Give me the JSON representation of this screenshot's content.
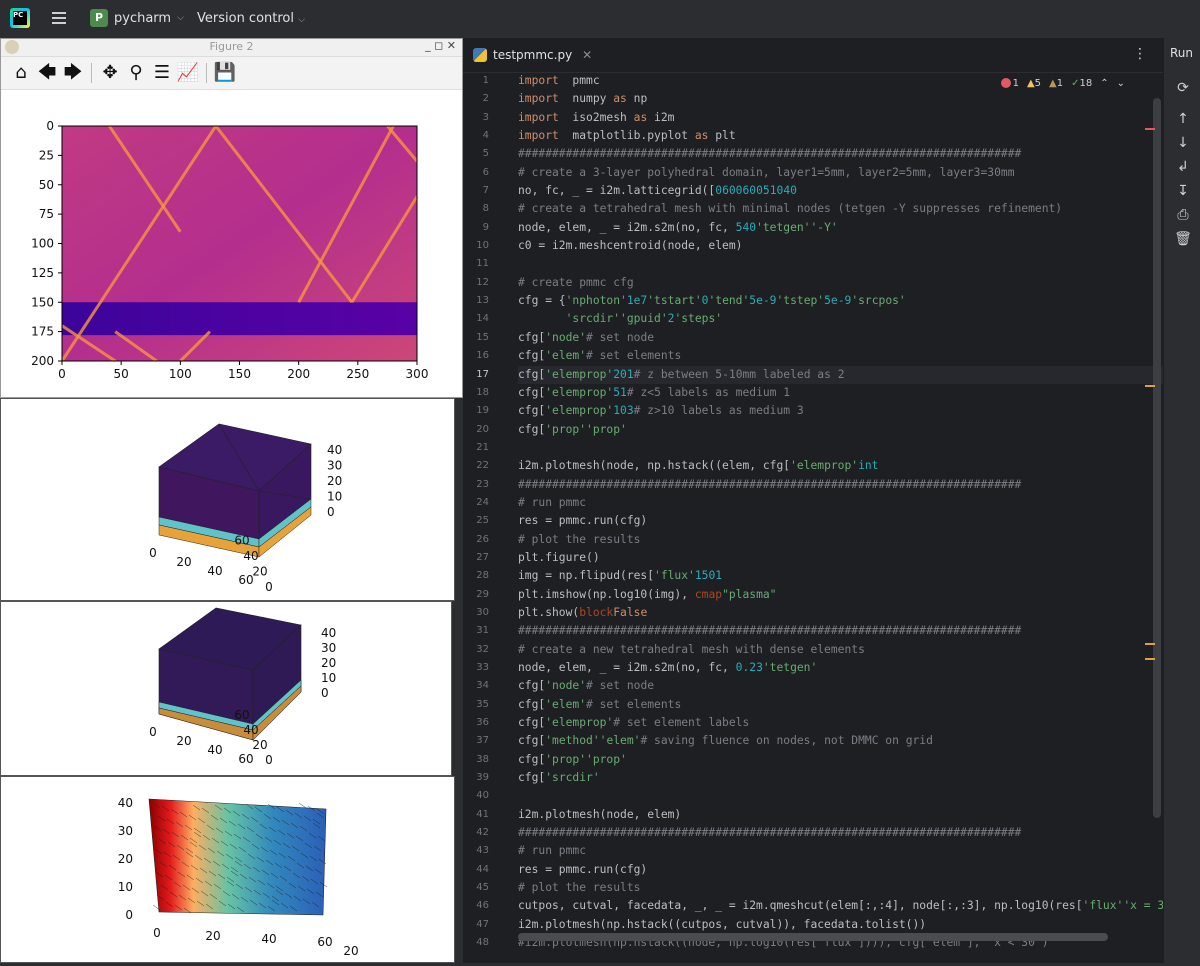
{
  "topbar": {
    "logo_text": "PC",
    "project_badge": "P",
    "project_name": "pycharm",
    "vcs_label": "Version control"
  },
  "figure_window": {
    "title": "Figure 2",
    "controls": "_ ◻ ✕",
    "toolbar_icons": [
      "home-icon",
      "back-icon",
      "forward-icon",
      "pan-icon",
      "zoom-icon",
      "configure-icon",
      "axes-icon",
      "save-icon"
    ]
  },
  "chart_data": [
    {
      "type": "heatmap",
      "x_ticks": [
        "0",
        "50",
        "100",
        "150",
        "200",
        "250",
        "300"
      ],
      "y_ticks": [
        "0",
        "25",
        "50",
        "75",
        "100",
        "125",
        "150",
        "175",
        "200"
      ],
      "xlim": [
        0,
        300
      ],
      "ylim": [
        200,
        0
      ],
      "colormap": "plasma"
    },
    {
      "type": "mesh3d",
      "x_ticks": [
        "0",
        "20",
        "40",
        "60"
      ],
      "y_ticks": [
        "0",
        "20",
        "40",
        "60"
      ],
      "z_ticks": [
        "0",
        "10",
        "20",
        "30",
        "40"
      ]
    },
    {
      "type": "mesh3d",
      "x_ticks": [
        "0",
        "20",
        "40",
        "60"
      ],
      "y_ticks": [
        "0",
        "20",
        "40",
        "60"
      ],
      "z_ticks": [
        "0",
        "10",
        "20",
        "30",
        "40"
      ]
    },
    {
      "type": "mesh3d",
      "x_ticks": [
        "0",
        "20",
        "40",
        "60"
      ],
      "z_ticks": [
        "0",
        "10",
        "20",
        "30",
        "40"
      ],
      "extra_label": "20"
    }
  ],
  "editor": {
    "tab_name": "testpmmc.py",
    "tab_close": "✕",
    "inspections": {
      "errors": "1",
      "warnings": "5",
      "weak": "1",
      "ok": "18"
    },
    "current_line": 17,
    "lines": [
      [
        [
          "kw",
          "import"
        ],
        [
          "",
          "  pmmc"
        ]
      ],
      [
        [
          "kw",
          "import"
        ],
        [
          "",
          "  numpy "
        ],
        [
          "kw",
          "as"
        ],
        [
          "",
          " np"
        ]
      ],
      [
        [
          "kw",
          "import"
        ],
        [
          "",
          "  iso2mesh "
        ],
        [
          "kw",
          "as"
        ],
        [
          "",
          " i2m"
        ]
      ],
      [
        [
          "kw",
          "import"
        ],
        [
          "",
          "  matplotlib.pyplot "
        ],
        [
          "kw",
          "as"
        ],
        [
          "",
          " plt"
        ]
      ],
      [
        [
          "cm",
          "##########################################################################"
        ]
      ],
      [
        [
          "cm",
          "# create a 3-layer polyhedral domain, layer1=5mm, layer2=5mm, layer3=30mm"
        ]
      ],
      [
        [
          "",
          "no, fc, _ = i2m.latticegrid(["
        ],
        [
          "nm",
          "0"
        ],
        [
          ", "
        ],
        [
          "nm",
          "60"
        ],
        [
          "], ["
        ],
        [
          "nm",
          "0"
        ],
        [
          ", "
        ],
        [
          "nm",
          "60"
        ],
        [
          "], ["
        ],
        [
          "nm",
          "0"
        ],
        [
          ", "
        ],
        [
          "nm",
          "5"
        ],
        [
          ", "
        ],
        [
          "nm",
          "10"
        ],
        [
          ", "
        ],
        [
          "nm",
          "40"
        ],
        [
          "])"
        ]
      ],
      [
        [
          "cm",
          "# create a tetrahedral mesh with minimal nodes (tetgen -Y suppresses refinement)"
        ]
      ],
      [
        [
          "",
          "node, elem, _ = i2m.s2m(no, fc, "
        ],
        [
          "nm",
          "5"
        ],
        [
          ", "
        ],
        [
          "nm",
          "40"
        ],
        [
          ", "
        ],
        [
          "st",
          "'tetgen'"
        ],
        [
          ", [[1,1,1],[1,1,6],[1,1,11]], [], "
        ],
        [
          "st",
          "'-Y'"
        ],
        [
          ")"
        ]
      ],
      [
        [
          "",
          "c0 = i2m.meshcentroid(node, elem)"
        ]
      ],
      [
        [
          "",
          ""
        ]
      ],
      [
        [
          "cm",
          "# create pmmc cfg"
        ]
      ],
      [
        [
          "",
          "cfg = {"
        ],
        [
          "st",
          "'nphoton'"
        ],
        [
          ": "
        ],
        [
          "nm",
          "1e7"
        ],
        [
          ", "
        ],
        [
          "st",
          "'tstart'"
        ],
        [
          ":"
        ],
        [
          "nm",
          "0"
        ],
        [
          ", "
        ],
        [
          "st",
          "'tend'"
        ],
        [
          ":"
        ],
        [
          "nm",
          "5e-9"
        ],
        [
          ", "
        ],
        [
          "st",
          "'tstep'"
        ],
        [
          ":"
        ],
        [
          "nm",
          "5e-9"
        ],
        [
          ", "
        ],
        [
          "st",
          "'srcpos'"
        ],
        [
          ": [30,5,0],"
        ]
      ],
      [
        [
          "",
          "       "
        ],
        [
          "st",
          "'srcdir'"
        ],
        [
          ": np.array([0,1,1])/(2**0.5), "
        ],
        [
          "st",
          "'gpuid'"
        ],
        [
          ": "
        ],
        [
          "nm",
          "2"
        ],
        [
          ", "
        ],
        [
          "st",
          "'steps'"
        ],
        [
          ": [0.2, 0.2, 0.2]}"
        ]
      ],
      [
        [
          "",
          "cfg["
        ],
        [
          "st",
          "'node'"
        ],
        [
          "]=node                                "
        ],
        [
          "cm",
          "# set node"
        ]
      ],
      [
        [
          "",
          "cfg["
        ],
        [
          "st",
          "'elem'"
        ],
        [
          "]=elem                                "
        ],
        [
          "cm",
          "# set elements"
        ]
      ],
      [
        [
          "",
          "cfg["
        ],
        [
          "st",
          "'elemprop'"
        ],
        [
          "] = "
        ],
        [
          "nm",
          "2"
        ],
        [
          "*np.ones((elem.shape["
        ],
        [
          "nm",
          "0"
        ],
        [
          "], "
        ],
        [
          "nm",
          "1"
        ],
        [
          ")) "
        ],
        [
          "cm",
          "# z between 5-10mm labeled as 2"
        ]
      ],
      [
        [
          "",
          "cfg["
        ],
        [
          "st",
          "'elemprop'"
        ],
        [
          "][c0[:,-1]<"
        ],
        [
          "nm",
          "5"
        ],
        [
          "] = "
        ],
        [
          "nm",
          "1"
        ],
        [
          "                  "
        ],
        [
          "cm",
          "# z<5 labels as medium 1"
        ]
      ],
      [
        [
          "",
          "cfg["
        ],
        [
          "st",
          "'elemprop'"
        ],
        [
          "][c0[:,-1]>"
        ],
        [
          "nm",
          "10"
        ],
        [
          "] = "
        ],
        [
          "nm",
          "3"
        ],
        [
          "                 "
        ],
        [
          "cm",
          "# z>10 labels as medium 3"
        ]
      ],
      [
        [
          "",
          "cfg["
        ],
        [
          "st",
          "'prop'"
        ],
        [
          "]=cfg["
        ],
        [
          "st",
          "'prop'"
        ],
        [
          "]=[[0,0,1,1],[0.001,0.001,0.9,1.37],[0.02,0,1,1],[0.0001,0.001,0.9,1.5]]"
        ]
      ],
      [
        [
          "",
          ""
        ]
      ],
      [
        [
          "",
          "i2m.plotmesh(node, np.hstack((elem, cfg["
        ],
        [
          "st",
          "'elemprop'"
        ],
        [
          "])).astype("
        ],
        [
          "nm",
          "int"
        ],
        [
          "))"
        ]
      ],
      [
        [
          "cm",
          "##########################################################################"
        ]
      ],
      [
        [
          "cm",
          "# run pmmc"
        ]
      ],
      [
        [
          "",
          "res = pmmc.run(cfg)"
        ]
      ],
      [
        [
          "cm",
          "# plot the results"
        ]
      ],
      [
        [
          "",
          "plt.figure()"
        ]
      ],
      [
        [
          "",
          "img = np.flipud(res["
        ],
        [
          "st",
          "'flux'"
        ],
        [
          "]["
        ],
        [
          "nm",
          "150"
        ],
        [
          "-"
        ],
        [
          "nm",
          "1"
        ],
        [
          ",:,:,:].squeeze().T)"
        ]
      ],
      [
        [
          "",
          "plt.imshow(np.log10(img), "
        ],
        [
          "pr",
          "cmap"
        ],
        [
          "=plt.get_cmap("
        ],
        [
          "st",
          "\"plasma\""
        ],
        [
          "))"
        ]
      ],
      [
        [
          "",
          "plt.show("
        ],
        [
          "pr",
          "block"
        ],
        [
          "="
        ],
        [
          "kw",
          "False"
        ],
        [
          ")"
        ]
      ],
      [
        [
          "cm",
          "##########################################################################"
        ]
      ],
      [
        [
          "cm",
          "# create a new tetrahedral mesh with dense elements"
        ]
      ],
      [
        [
          "",
          "node, elem, _ = i2m.s2m(no, fc, "
        ],
        [
          "nm",
          "0.2"
        ],
        [
          ", "
        ],
        [
          "nm",
          "3"
        ],
        [
          ", "
        ],
        [
          "st",
          "'tetgen'"
        ],
        [
          ", [[1,1,1],[1,1,6],[1,1,11]])"
        ]
      ],
      [
        [
          "",
          "cfg["
        ],
        [
          "st",
          "'node'"
        ],
        [
          "]=node[:,:3]                       "
        ],
        [
          "cm",
          "# set node"
        ]
      ],
      [
        [
          "",
          "cfg["
        ],
        [
          "st",
          "'elem'"
        ],
        [
          "]=elem[:,:4]                       "
        ],
        [
          "cm",
          "# set elements"
        ]
      ],
      [
        [
          "",
          "cfg["
        ],
        [
          "st",
          "'elemprop'"
        ],
        [
          "] = elem[:,4]                   "
        ],
        [
          "cm",
          "# set element labels"
        ]
      ],
      [
        [
          "",
          "cfg["
        ],
        [
          "st",
          "'method'"
        ],
        [
          "] = "
        ],
        [
          "st",
          "'elem'"
        ],
        [
          "                      "
        ],
        [
          "cm",
          "# saving fluence on nodes, not DMMC on grid"
        ]
      ],
      [
        [
          "",
          "cfg["
        ],
        [
          "st",
          "'prop'"
        ],
        [
          "]=cfg["
        ],
        [
          "st",
          "'prop'"
        ],
        [
          "]=[[0,0,1,1],[0.001,0.1,0.5,1.37],[0.0002,0,1,1],[0.003,1,0.9,1.5]]"
        ]
      ],
      [
        [
          "",
          "cfg["
        ],
        [
          "st",
          "'srcdir'"
        ],
        [
          "]=[0,0,1]"
        ]
      ],
      [
        [
          "",
          ""
        ]
      ],
      [
        [
          "",
          "i2m.plotmesh(node, elem)"
        ]
      ],
      [
        [
          "cm",
          "##########################################################################"
        ]
      ],
      [
        [
          "cm",
          "# run pmmc"
        ]
      ],
      [
        [
          "",
          "res = pmmc.run(cfg)"
        ]
      ],
      [
        [
          "cm",
          "# plot the results"
        ]
      ],
      [
        [
          "",
          "cutpos, cutval, facedata, _, _ = i2m.qmeshcut(elem[:,:4], node[:,:3], np.log10(res["
        ],
        [
          "st",
          "'flux'"
        ],
        [
          "]), "
        ],
        [
          "st",
          "'x = 30'"
        ],
        [
          ")"
        ]
      ],
      [
        [
          "",
          "i2m.plotmesh(np.hstack((cutpos, cutval)), facedata.tolist())"
        ]
      ],
      [
        [
          "cm",
          "#i2m.plotmesh(np.hstack((node, np.log10(res['flux']))), cfg['elem'], 'x < 30')"
        ]
      ]
    ]
  },
  "rightbar": {
    "run_label": "Run",
    "icons": [
      "rerun-icon",
      "up-arrow-icon",
      "down-arrow-icon",
      "wrap-icon",
      "scroll-end-icon",
      "print-icon",
      "trash-icon"
    ]
  }
}
